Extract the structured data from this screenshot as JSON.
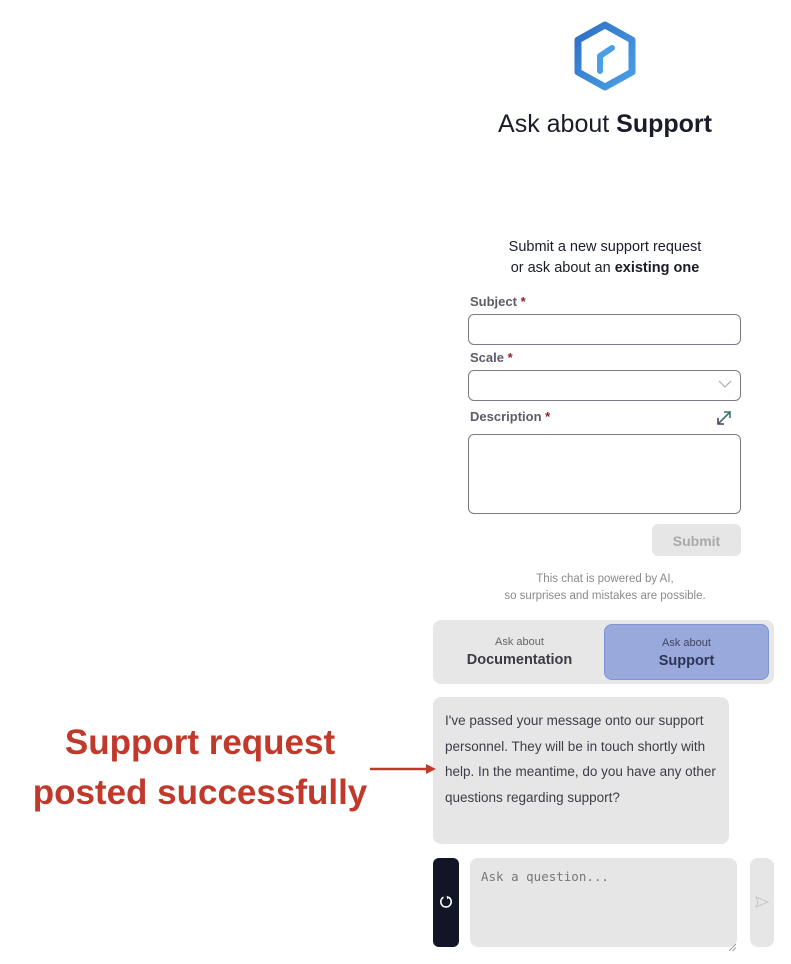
{
  "header": {
    "logo_icon": "hexagon-logo-icon",
    "title_prefix": "Ask about ",
    "title_bold": "Support"
  },
  "intro": {
    "line1": "Submit a new support request",
    "line2_prefix": "or ask about an ",
    "line2_bold": "existing one"
  },
  "form": {
    "subject": {
      "label": "Subject",
      "required_mark": "*",
      "value": ""
    },
    "scale": {
      "label": "Scale",
      "required_mark": "*",
      "selected": ""
    },
    "description": {
      "label": "Description",
      "required_mark": "*",
      "value": ""
    },
    "submit_label": "Submit"
  },
  "disclaimer": {
    "line1": "This chat is powered by AI,",
    "line2": "so surprises and mistakes are possible."
  },
  "mode_toggle": {
    "options": [
      {
        "small": "Ask about",
        "big": "Documentation",
        "active": false
      },
      {
        "small": "Ask about",
        "big": "Support",
        "active": true
      }
    ]
  },
  "chat": {
    "messages": [
      {
        "role": "assistant",
        "text": "I've passed your message onto our support personnel. They will be in touch shortly with help. In the meantime, do you have any other questions regarding support?"
      }
    ],
    "input": {
      "placeholder": "Ask a question...",
      "value": ""
    }
  },
  "annotation": {
    "line1": "Support request",
    "line2": "posted successfully",
    "color": "#c0392b"
  },
  "colors": {
    "logo_blue": "#3a7fcf",
    "active_tab": "#9aa9dc",
    "reset_button": "#111526"
  }
}
